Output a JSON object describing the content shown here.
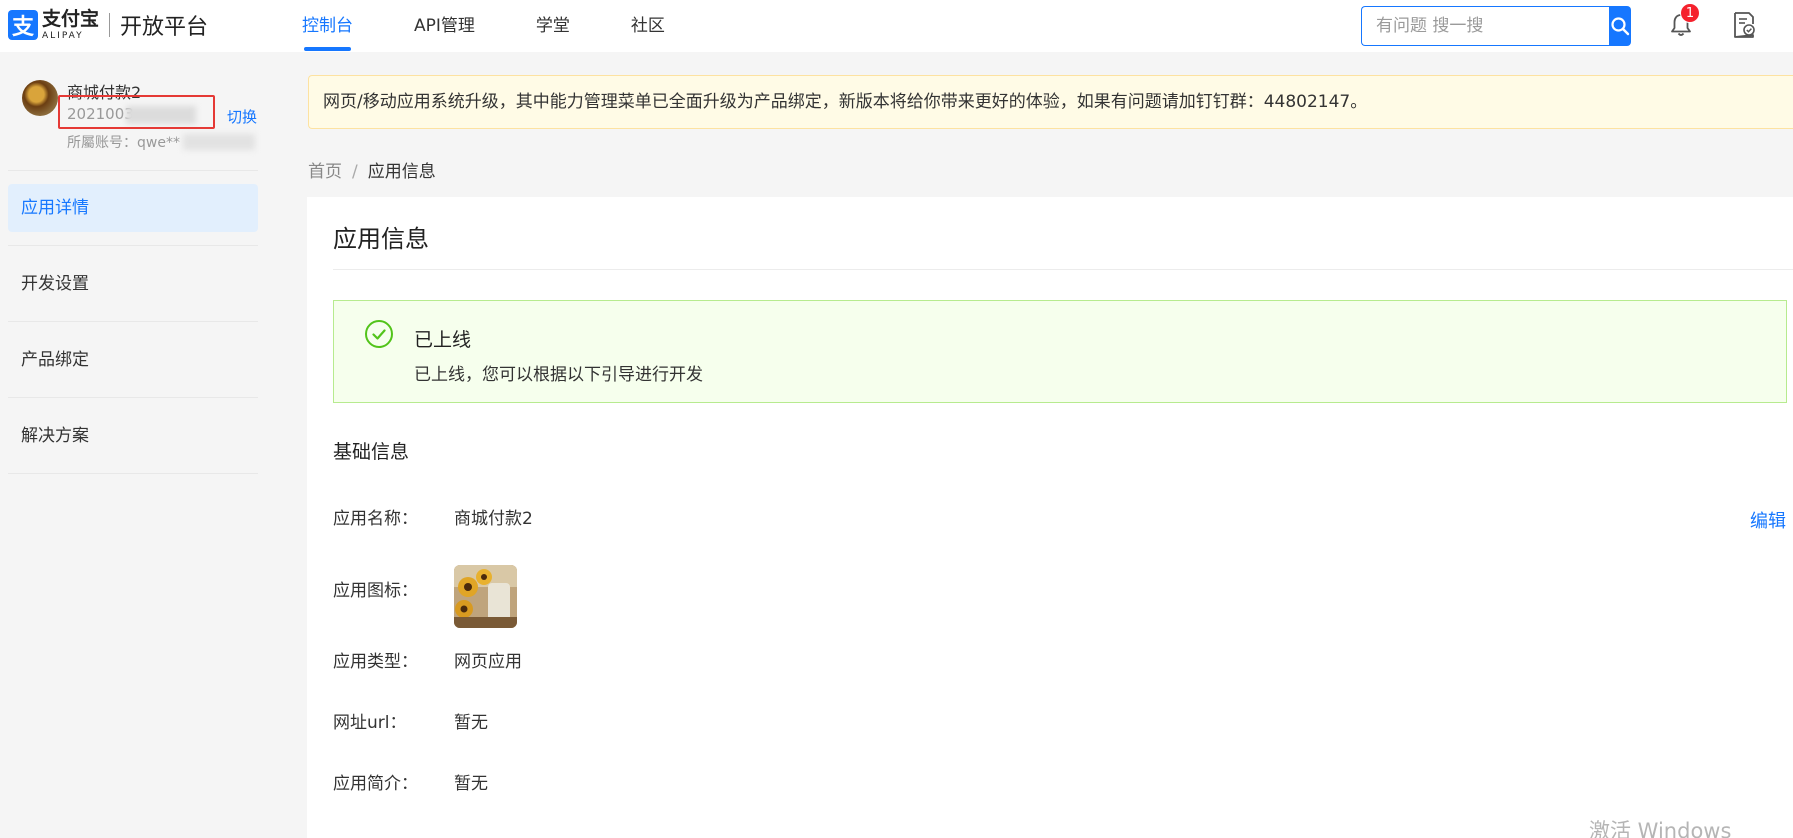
{
  "header": {
    "logo_cn": "支付宝",
    "logo_en": "ALIPAY",
    "platform": "开放平台",
    "nav": [
      {
        "label": "控制台",
        "active": true
      },
      {
        "label": "API管理"
      },
      {
        "label": "学堂"
      },
      {
        "label": "社区"
      }
    ],
    "search_placeholder": "有问题 搜一搜",
    "notification_count": "1",
    "accent_color": "#1677ff"
  },
  "sidebar": {
    "account_name": "商城付款2",
    "account_id_visible": "2021003",
    "switch_label": "切换",
    "owner_label": "所屬账号：qwe**",
    "menu": [
      {
        "label": "应用详情",
        "active": true
      },
      {
        "label": "开发设置"
      },
      {
        "label": "产品绑定"
      },
      {
        "label": "解决方案"
      }
    ]
  },
  "notice": {
    "text": "网页/移动应用系统升级，其中能力管理菜单已全面升级为产品绑定，新版本将给你带来更好的体验，如果有问题请加钉钉群：44802147。"
  },
  "breadcrumb": {
    "home": "首页",
    "separator": "/",
    "current": "应用信息"
  },
  "main": {
    "title": "应用信息",
    "status": {
      "title": "已上线",
      "description": "已上线，您可以根据以下引导进行开发",
      "color": "#52c41a"
    },
    "section_title": "基础信息",
    "edit_label": "编辑",
    "fields": [
      {
        "label": "应用名称：",
        "value": "商城付款2"
      },
      {
        "label": "应用图标：",
        "value": ""
      },
      {
        "label": "应用类型：",
        "value": "网页应用"
      },
      {
        "label": "网址url：",
        "value": "暂无"
      },
      {
        "label": "应用简介：",
        "value": "暂无"
      }
    ]
  },
  "watermark": "激活 Windows"
}
